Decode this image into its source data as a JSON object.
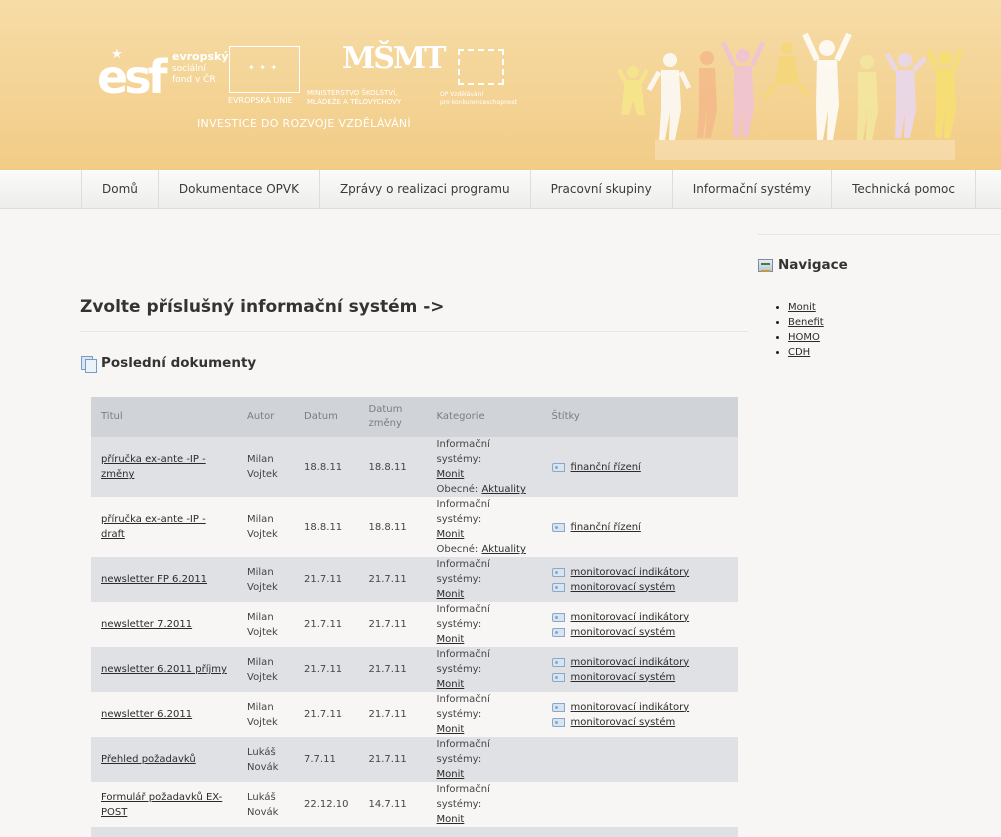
{
  "header": {
    "esf_big": "esf",
    "esf_line1": "evropský",
    "esf_line2": "sociální",
    "esf_line3": "fond v ČR",
    "eu_caption": "EVROPSKÁ UNIE",
    "msmt_mark": "MŠMT",
    "msmt_caption1": "MINISTERSTVO ŠKOLSTVÍ,",
    "msmt_caption2": "MLÁDEŽE A TĚLOVÝCHOVY",
    "op_caption1": "OP Vzdělávání",
    "op_caption2": "pro konkurenceschopnost",
    "slogan": "INVESTICE DO ROZVOJE VZDĚLÁVÁNÍ"
  },
  "nav": {
    "items": [
      {
        "label": "Domů"
      },
      {
        "label": "Dokumentace OPVK"
      },
      {
        "label": "Zprávy o realizaci programu"
      },
      {
        "label": "Pracovní skupiny"
      },
      {
        "label": "Informační systémy"
      },
      {
        "label": "Technická pomoc"
      }
    ]
  },
  "main": {
    "page_title": "Zvolte příslušný informační systém ->",
    "section_title": "Poslední dokumenty",
    "table": {
      "headers": [
        "Titul",
        "Autor",
        "Datum",
        "Datum změny",
        "Kategorie",
        "Štítky"
      ],
      "rows": [
        {
          "title": "příručka ex-ante -IP - změny",
          "author": "Milan Vojtek",
          "date": "18.8.11",
          "changed": "18.8.11",
          "cat_label": "Informační systémy:",
          "cat_link": "Monit",
          "cat2_label": "Obecné:",
          "cat2_link": "Aktuality",
          "tags": [
            "finanční řízení"
          ]
        },
        {
          "title": "příručka ex-ante -IP - draft",
          "author": "Milan Vojtek",
          "date": "18.8.11",
          "changed": "18.8.11",
          "cat_label": "Informační systémy:",
          "cat_link": "Monit",
          "cat2_label": "Obecné:",
          "cat2_link": "Aktuality",
          "tags": [
            "finanční řízení"
          ]
        },
        {
          "title": "newsletter FP 6.2011",
          "author": "Milan Vojtek",
          "date": "21.7.11",
          "changed": "21.7.11",
          "cat_label": "Informační systémy:",
          "cat_link": "Monit",
          "tags": [
            "monitorovací indikátory",
            "monitorovací systém"
          ]
        },
        {
          "title": "newsletter 7.2011",
          "author": "Milan Vojtek",
          "date": "21.7.11",
          "changed": "21.7.11",
          "cat_label": "Informační systémy:",
          "cat_link": "Monit",
          "tags": [
            "monitorovací indikátory",
            "monitorovací systém"
          ]
        },
        {
          "title": "newsletter 6.2011 příjmy",
          "author": "Milan Vojtek",
          "date": "21.7.11",
          "changed": "21.7.11",
          "cat_label": "Informační systémy:",
          "cat_link": "Monit",
          "tags": [
            "monitorovací indikátory",
            "monitorovací systém"
          ]
        },
        {
          "title": "newsletter 6.2011",
          "author": "Milan Vojtek",
          "date": "21.7.11",
          "changed": "21.7.11",
          "cat_label": "Informační systémy:",
          "cat_link": "Monit",
          "tags": [
            "monitorovací indikátory",
            "monitorovací systém"
          ]
        },
        {
          "title": "Přehled požadavků",
          "author": "Lukáš Novák",
          "date": "7.7.11",
          "changed": "21.7.11",
          "cat_label": "Informační systémy:",
          "cat_link": "Monit",
          "tags": []
        },
        {
          "title": "Formulář požadavků EX-POST",
          "author": "Lukáš Novák",
          "date": "22.12.10",
          "changed": "14.7.11",
          "cat_label": "Informační systémy:",
          "cat_link": "Monit",
          "tags": []
        }
      ]
    }
  },
  "sidebar": {
    "title": "Navigace",
    "links": [
      "Monit",
      "Benefit",
      "HOMO",
      "CDH"
    ]
  }
}
